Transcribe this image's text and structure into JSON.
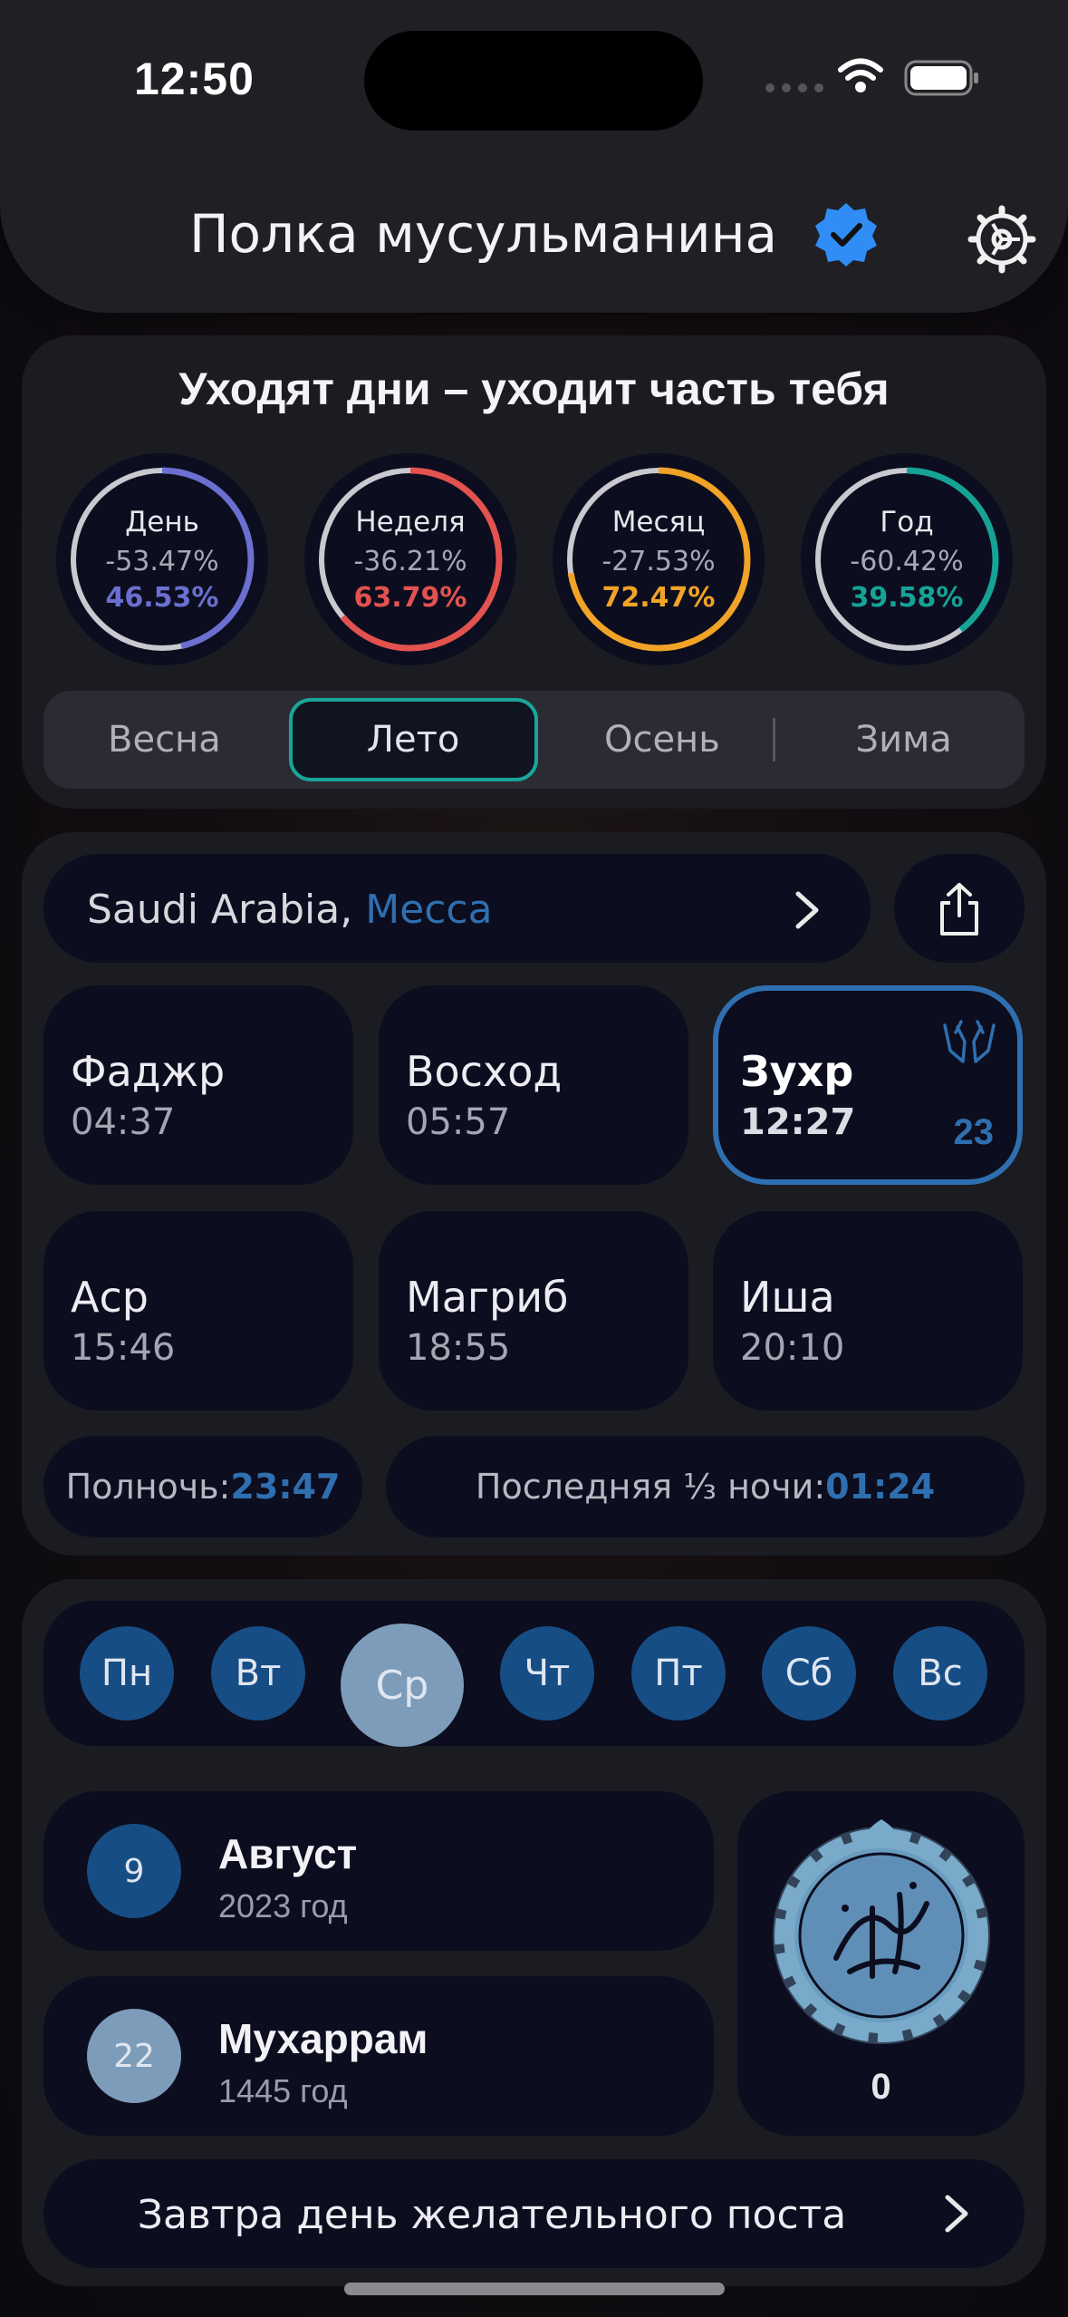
{
  "status": {
    "time": "12:50"
  },
  "header": {
    "title": "Полка мусульманина"
  },
  "progress": {
    "heading": "Уходят дни – уходит часть тебя",
    "rings": [
      {
        "label": "День",
        "passed": "-53.47%",
        "left": "46.53%",
        "fraction": 0.4653,
        "color": "#6a6fd0"
      },
      {
        "label": "Неделя",
        "passed": "-36.21%",
        "left": "63.79%",
        "fraction": 0.6379,
        "color": "#e2524f"
      },
      {
        "label": "Месяц",
        "passed": "-27.53%",
        "left": "72.47%",
        "fraction": 0.7247,
        "color": "#f0a326"
      },
      {
        "label": "Год",
        "passed": "-60.42%",
        "left": "39.58%",
        "fraction": 0.3958,
        "color": "#16a396"
      }
    ]
  },
  "seasons": [
    "Весна",
    "Лето",
    "Осень",
    "Зима"
  ],
  "location": {
    "country": "Saudi Arabia,",
    "city": "Мecca"
  },
  "prayers": [
    {
      "name": "Фаджр",
      "time": "04:37"
    },
    {
      "name": "Восход",
      "time": "05:57"
    },
    {
      "name": "Зухр",
      "time": "12:27",
      "count": "23"
    },
    {
      "name": "Аср",
      "time": "15:46"
    },
    {
      "name": "Магриб",
      "time": "18:55"
    },
    {
      "name": "Иша",
      "time": "20:10"
    }
  ],
  "night": {
    "midnight_label": "Полночь: ",
    "midnight": "23:47",
    "last_third_label": "Последняя ⅓ ночи: ",
    "last_third": "01:24"
  },
  "weekdays": [
    "Пн",
    "Вт",
    "Ср",
    "Чт",
    "Пт",
    "Сб",
    "Вс"
  ],
  "calendar": {
    "gregorian": {
      "day": "9",
      "month": "Август",
      "year": "2023 год"
    },
    "hijri": {
      "day": "22",
      "month": "Мухаррам",
      "year": "1445 год"
    },
    "salawat_count": "0"
  },
  "footer": {
    "text": "Завтра день желательного поста"
  },
  "colors": {
    "accent": "#2f6fb0",
    "card": "#0c0d1e",
    "panel": "#1b1b22"
  }
}
